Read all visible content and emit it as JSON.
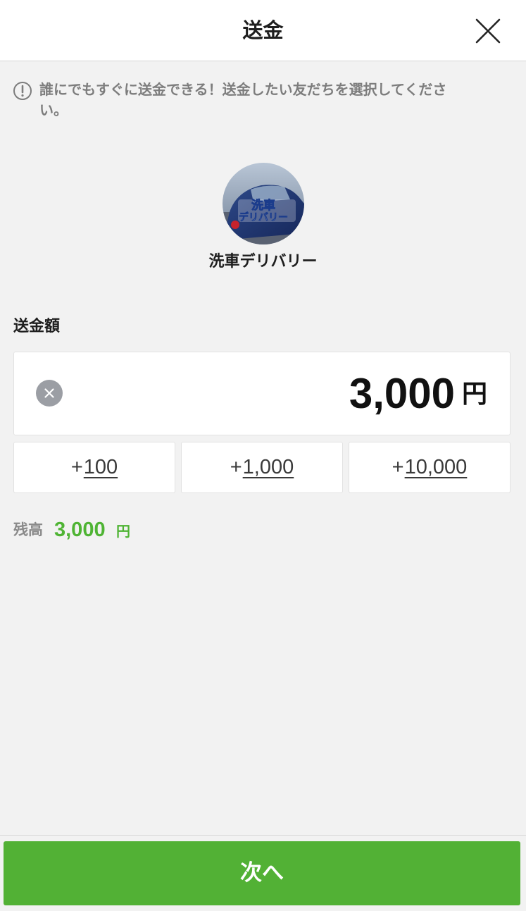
{
  "header": {
    "title": "送金",
    "close_icon": "close-icon"
  },
  "notice": {
    "icon": "exclamation-circle-icon",
    "text": "誰にでもすぐに送金できる！送金したい友だちを選択してください。"
  },
  "recipient": {
    "name": "洗車デリバリー",
    "avatar_text_line1": "洗車",
    "avatar_text_line2": "デリバリー"
  },
  "amount": {
    "label": "送金額",
    "value": "3,000",
    "unit": "円",
    "clear_icon": "clear-circle-icon"
  },
  "quick_add": [
    {
      "plus": "+",
      "amount": "100"
    },
    {
      "plus": "+",
      "amount": "1,000"
    },
    {
      "plus": "+",
      "amount": "10,000"
    }
  ],
  "balance": {
    "label": "残高",
    "value": "3,000",
    "unit": "円"
  },
  "next_button": {
    "label": "次へ"
  },
  "colors": {
    "accent_green": "#52b135",
    "balance_green": "#4fb434",
    "background": "#f2f2f2"
  }
}
